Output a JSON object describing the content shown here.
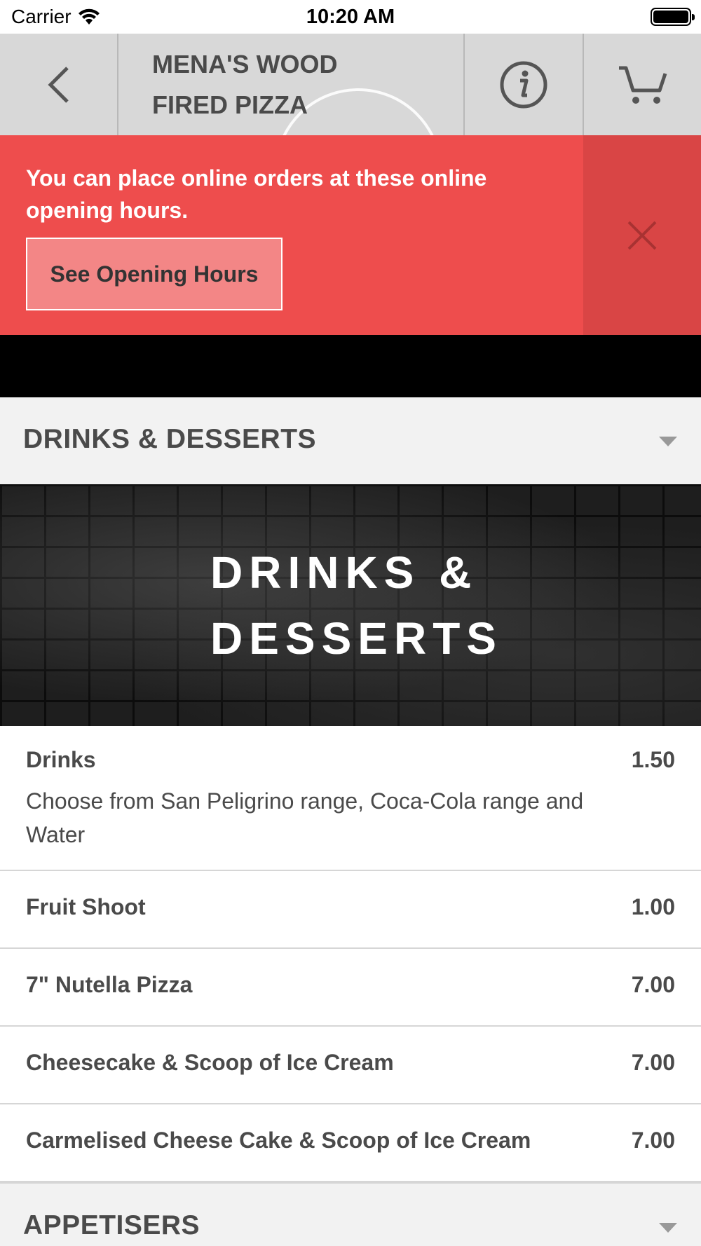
{
  "status_bar": {
    "carrier": "Carrier",
    "time": "10:20 AM"
  },
  "header": {
    "title": "MENA'S WOOD FIRED PIZZA",
    "back_icon": "chevron-left-icon",
    "info_icon": "info-icon",
    "cart_icon": "cart-icon"
  },
  "banner": {
    "message": "You can place online orders at these online opening hours.",
    "button_label": "See Opening Hours",
    "close_icon": "close-icon",
    "background_color": "#ee4d4d"
  },
  "categories": [
    {
      "label": "DRINKS & DESSERTS"
    },
    {
      "label": "APPETISERS"
    }
  ],
  "category_banner": {
    "title": "DRINKS & DESSERTS"
  },
  "menu_items": [
    {
      "name": "Drinks",
      "price": "1.50",
      "description": "Choose from San Peligrino range, Coca-Cola range and Water"
    },
    {
      "name": "Fruit Shoot",
      "price": "1.00"
    },
    {
      "name": "7\" Nutella Pizza",
      "price": "7.00"
    },
    {
      "name": "Cheesecake & Scoop of Ice Cream",
      "price": "7.00"
    },
    {
      "name": "Carmelised Cheese Cake & Scoop of Ice Cream",
      "price": "7.00"
    }
  ]
}
